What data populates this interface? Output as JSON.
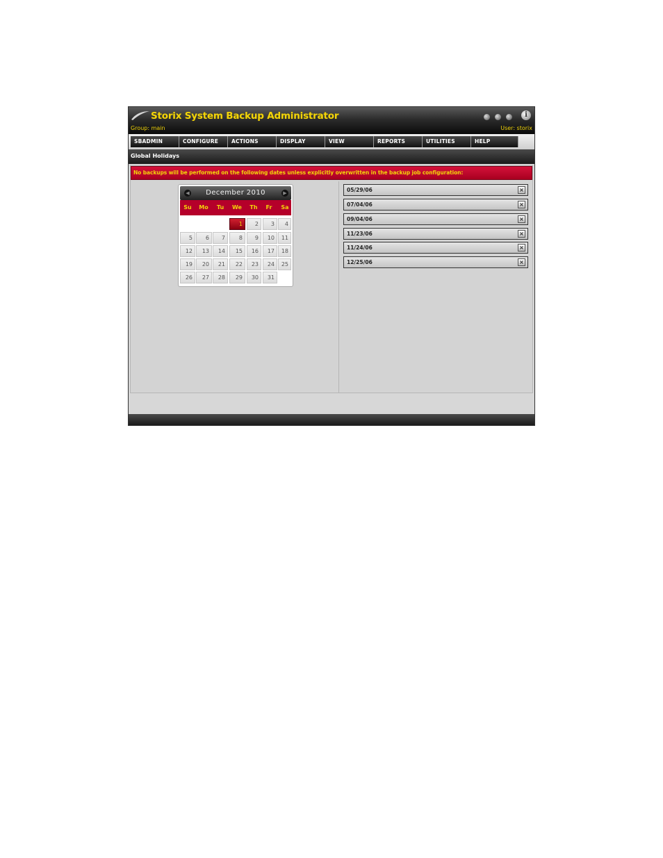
{
  "header": {
    "title": "Storix System Backup Administrator",
    "group_label": "Group: main",
    "user_label": "User: storix",
    "info_glyph": "i"
  },
  "menu": [
    {
      "label": "SBADMIN"
    },
    {
      "label": "CONFIGURE"
    },
    {
      "label": "ACTIONS"
    },
    {
      "label": "DISPLAY"
    },
    {
      "label": "VIEW"
    },
    {
      "label": "REPORTS"
    },
    {
      "label": "UTILITIES"
    },
    {
      "label": "HELP"
    }
  ],
  "section": {
    "title": "Global Holidays"
  },
  "notice": {
    "text": "No backups will be performed on the following dates unless explicitly overwritten in the backup job configuration:"
  },
  "calendar": {
    "title": "December 2010",
    "weekdays": [
      "Su",
      "Mo",
      "Tu",
      "We",
      "Th",
      "Fr",
      "Sa"
    ],
    "days": [
      "1",
      "2",
      "3",
      "4",
      "5",
      "6",
      "7",
      "8",
      "9",
      "10",
      "11",
      "12",
      "13",
      "14",
      "15",
      "16",
      "17",
      "18",
      "19",
      "20",
      "21",
      "22",
      "23",
      "24",
      "25",
      "26",
      "27",
      "28",
      "29",
      "30",
      "31"
    ],
    "selected_day": "1"
  },
  "holidays": [
    {
      "date": "05/29/06"
    },
    {
      "date": "07/04/06"
    },
    {
      "date": "09/04/06"
    },
    {
      "date": "11/23/06"
    },
    {
      "date": "11/24/06"
    },
    {
      "date": "12/25/06"
    }
  ],
  "icons": {
    "logo": "swoosh-logo-icon",
    "window_controls": "circle-button-icon",
    "info": "info-icon",
    "prev": "chevron-left-icon",
    "next": "chevron-right-icon",
    "remove": "close-icon"
  },
  "colors": {
    "accent_yellow": "#f2d40a",
    "notice_red": "#b5002a",
    "header_dark": "#1a1a1a"
  }
}
